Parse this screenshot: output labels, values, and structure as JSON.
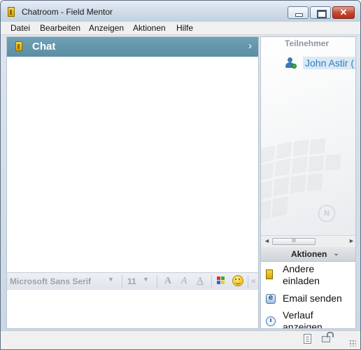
{
  "window": {
    "title": "Chatroom - Field Mentor",
    "close_glyph": "✕"
  },
  "menu": {
    "items": [
      "Datei",
      "Bearbeiten",
      "Anzeigen",
      "Aktionen",
      "Hilfe"
    ]
  },
  "chat": {
    "title": "Chat",
    "chevron": "›",
    "accent_color": "#5b8ea3"
  },
  "formatting": {
    "font_name": "Microsoft Sans Serif",
    "font_size": "11",
    "bold_glyph": "A",
    "italic_glyph": "A",
    "underline_glyph": "A",
    "dropdown_arrow": "▼",
    "more_glyph": "«"
  },
  "participants": {
    "header": "Teilnehmer",
    "items": [
      {
        "name": "John Astir (",
        "status": "online"
      }
    ],
    "logo_letter": "N"
  },
  "scrollbar": {
    "left_arrow": "◄",
    "right_arrow": "►",
    "thumb_grip": "III"
  },
  "actions": {
    "header": "Aktionen",
    "chevron": "⌄",
    "items": [
      {
        "label_line1": "Andere",
        "label_line2": "einladen",
        "icon": "invite-icon"
      },
      {
        "label_line1": "Email senden",
        "icon": "email-icon"
      },
      {
        "label_line1": "Verlauf",
        "label_line2": "anzeigen",
        "icon": "history-icon"
      }
    ]
  }
}
